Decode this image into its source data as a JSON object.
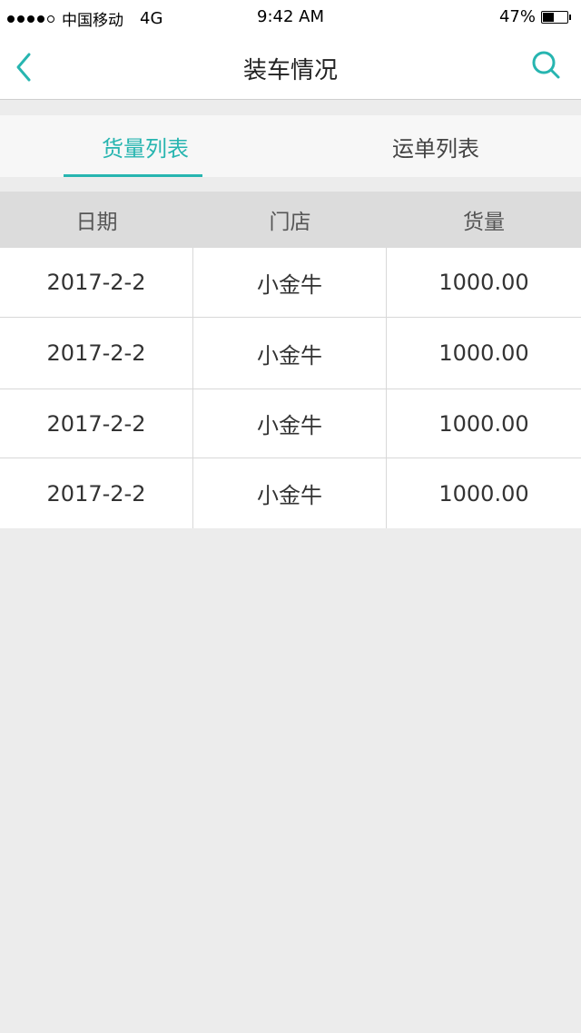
{
  "status_bar": {
    "carrier": "中国移动",
    "network": "4G",
    "time": "9:42 AM",
    "battery": "47%",
    "battery_level": 0.47
  },
  "nav": {
    "title": "装车情况",
    "back_icon": "chevron-left-icon",
    "search_icon": "search-icon",
    "accent_color": "#27b5b0"
  },
  "tabs": [
    {
      "label": "货量列表",
      "active": true
    },
    {
      "label": "运单列表",
      "active": false
    }
  ],
  "table": {
    "headers": [
      "日期",
      "门店",
      "货量"
    ],
    "rows": [
      [
        "2017-2-2",
        "小金牛",
        "1000.00"
      ],
      [
        "2017-2-2",
        "小金牛",
        "1000.00"
      ],
      [
        "2017-2-2",
        "小金牛",
        "1000.00"
      ],
      [
        "2017-2-2",
        "小金牛",
        "1000.00"
      ]
    ]
  }
}
